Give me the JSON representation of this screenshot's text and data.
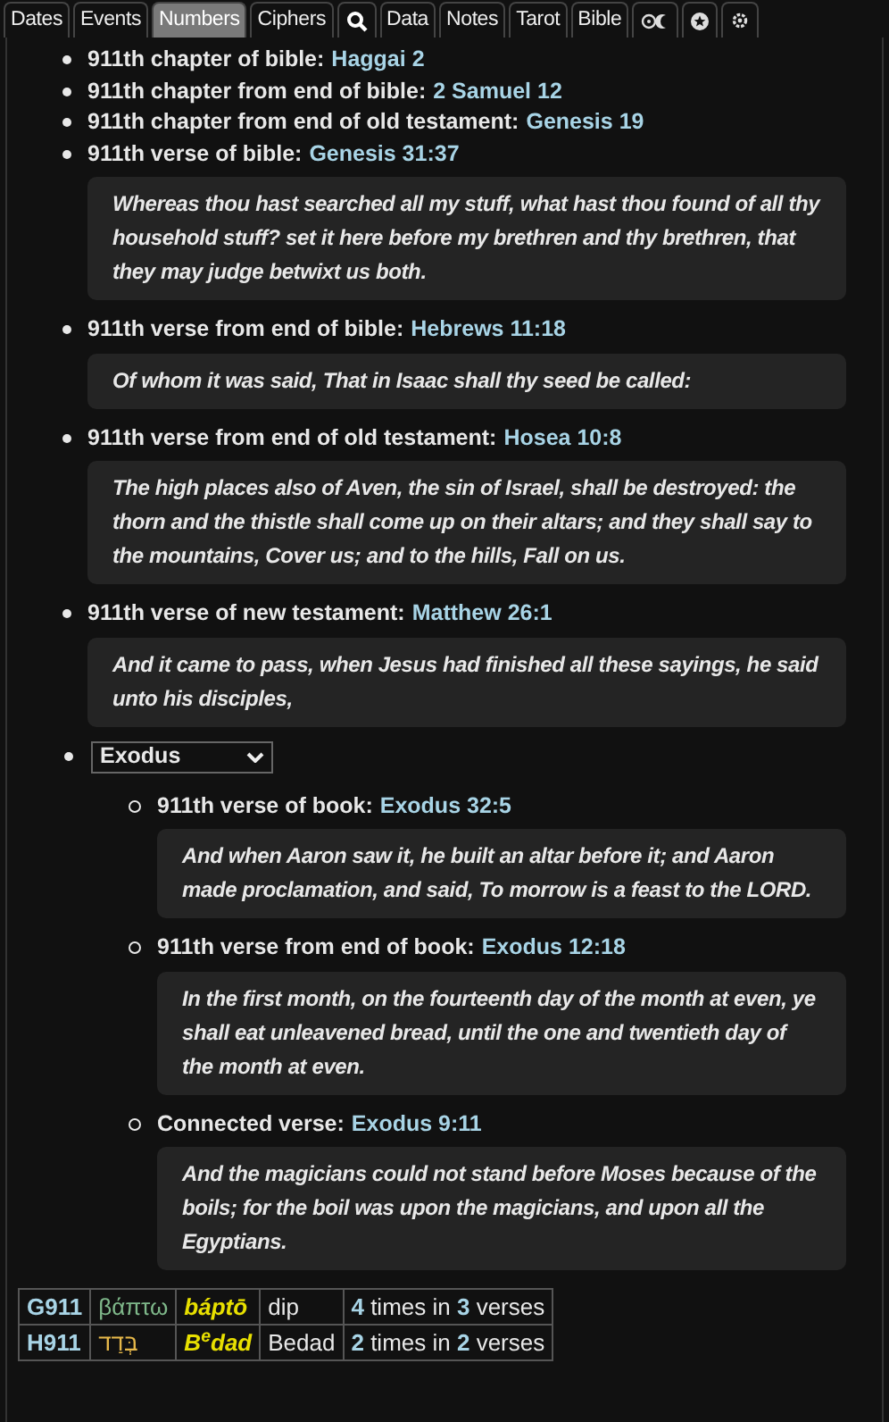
{
  "tabs": [
    {
      "kind": "text",
      "label": "Dates",
      "selected": false
    },
    {
      "kind": "text",
      "label": "Events",
      "selected": false
    },
    {
      "kind": "text",
      "label": "Numbers",
      "selected": true
    },
    {
      "kind": "text",
      "label": "Ciphers",
      "selected": false
    },
    {
      "kind": "search",
      "selected": false
    },
    {
      "kind": "text",
      "label": "Data",
      "selected": false
    },
    {
      "kind": "text",
      "label": "Notes",
      "selected": false
    },
    {
      "kind": "text",
      "label": "Tarot",
      "selected": false
    },
    {
      "kind": "text",
      "label": "Bible",
      "selected": false
    },
    {
      "kind": "sun-moon",
      "selected": false
    },
    {
      "kind": "star",
      "selected": false
    },
    {
      "kind": "settings",
      "selected": false
    }
  ],
  "items": [
    {
      "label": "911th chapter of bible:",
      "reference": "Haggai 2"
    },
    {
      "label": "911th chapter from end of bible:",
      "reference": "2 Samuel 12"
    },
    {
      "label": "911th chapter from end of old testament:",
      "reference": "Genesis 19"
    },
    {
      "label": "911th verse of bible:",
      "reference": "Genesis 31:37",
      "quote": "Whereas thou hast searched all my stuff, what hast thou found of all thy household stuff? set it here before my brethren and thy brethren, that they may judge betwixt us both."
    },
    {
      "label": "911th verse from end of bible:",
      "reference": "Hebrews 11:18",
      "quote": "Of whom it was said, That in Isaac shall thy seed be called:"
    },
    {
      "label": "911th verse from end of old testament:",
      "reference": "Hosea 10:8",
      "quote": "The high places also of Aven, the sin of Israel, shall be destroyed: the thorn and the thistle shall come up on their altars; and they shall say to the mountains, Cover us; and to the hills, Fall on us."
    },
    {
      "label": "911th verse of new testament:",
      "reference": "Matthew 26:1",
      "quote": "And it came to pass, when Jesus had finished all these sayings, he said unto his disciples,"
    }
  ],
  "book_select": {
    "value": "Exodus"
  },
  "book_items": [
    {
      "label": "911th verse of book:",
      "reference": "Exodus 32:5",
      "quote": "And when Aaron saw it, he built an altar before it; and Aaron made proclamation, and said, To morrow is a feast to the LORD."
    },
    {
      "label": "911th verse from end of book:",
      "reference": "Exodus 12:18",
      "quote": "In the first month, on the fourteenth day of the month at even, ye shall eat unleavened bread, until the one and twentieth day of the month at even."
    },
    {
      "label": "Connected verse:",
      "reference": "Exodus 9:11",
      "quote": "And the magicians could not stand before Moses because of the boils; for the boil was upon the magicians, and upon all the Egyptians."
    }
  ],
  "strongs": [
    {
      "number": "G911",
      "original": "βάπτω",
      "transliteration": "báptō",
      "meaning": "dip",
      "usage": "**4** times in **3** verses"
    },
    {
      "number": "H911",
      "original": "בְּדַד",
      "transliteration": "B$^{e}$dad",
      "meaning": "Bedad",
      "usage": "**2** times in **2** verses"
    }
  ]
}
